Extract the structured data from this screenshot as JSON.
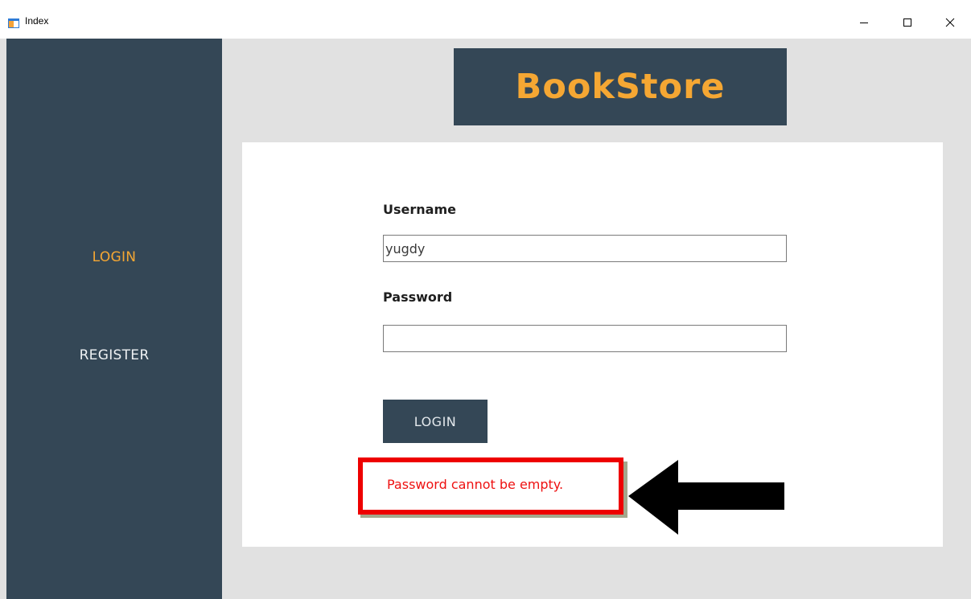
{
  "window": {
    "title": "Index",
    "icon": "app-window-icon",
    "controls": [
      "minimize-icon",
      "maximize-icon",
      "close-icon"
    ]
  },
  "sidebar": {
    "items": [
      {
        "label": "LOGIN",
        "active": true
      },
      {
        "label": "REGISTER",
        "active": false
      }
    ]
  },
  "brand": {
    "title": "BookStore"
  },
  "form": {
    "username_label": "Username",
    "username_value": "yugdy",
    "password_label": "Password",
    "password_value": "",
    "login_button": "LOGIN",
    "error_message": "Password cannot be empty."
  },
  "annotation": {
    "arrow_icon": "left-arrow-icon"
  },
  "colors": {
    "sidebar_bg": "#344756",
    "accent": "#f5a733",
    "error": "#ee0000",
    "content_bg": "#e1e1e1"
  }
}
